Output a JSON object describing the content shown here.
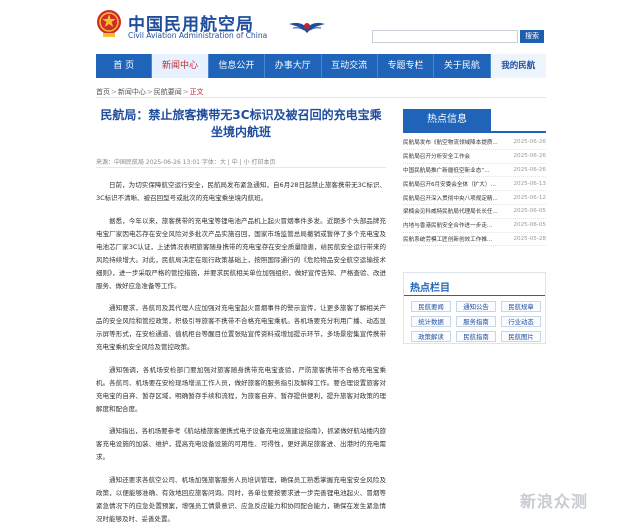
{
  "header": {
    "site_name_cn": "中国民用航空局",
    "site_name_en": "Civil Aviation Administration of China",
    "search_button": "搜索"
  },
  "nav": {
    "items": [
      "首 页",
      "新闻中心",
      "信息公开",
      "办事大厅",
      "互动交流",
      "专题专栏",
      "关于民航",
      "我的民航"
    ]
  },
  "breadcrumb": {
    "home": "首页",
    "section": "新闻中心",
    "subsection": "民航要闻",
    "current": "正文"
  },
  "article": {
    "title": "民航局：禁止旅客携带无3C标识及被召回的充电宝乘坐境内航班",
    "meta": "来源：中国民航局    2025-06-26 13:01        字体：大 | 中 | 小    打印本页",
    "paragraphs": [
      "日前，为切实保障航空运行安全，民航局发布紧急通知，自6月28日起禁止旅客携带无3C标识、3C标识不清晰、被召回型号或批次的充电宝乘坐境内航班。",
      "据悉，今年以来，旅客携带的充电宝等锂电池产品机上起火冒烟事件多发。近期多个头部品牌充电宝厂家因电芯存在安全风险对多批次产品实施召回，国家市场监管总局撤销或暂停了多个充电宝及电池芯厂家3C认证，上述情况表明旅客随身携带的充电宝存在安全质量隐患，给民航安全运行带来的风险持续增大。对此，民航局决定在现行政策基础上，按照国际通行的《危险物品安全航空运输技术细则》，进一步采取严格的管控措施，并要求民航相关单位加强组织，做好宣传告知、严格查验、改进服务、做好应急准备等工作。",
      "通知要求，各航司及其代理人应加强对充电宝起火冒烟事件的警示宣传，让更多旅客了解相关产品的安全风险和管控政策，积极引导旅客不携带不合格充电宝乘机。各机场要充分利用广播、动态显示屏等形式，在安检通道、值机柜台等醒目位置张贴宣传资料或增加提示环节，多场景密集宣传携带充电宝乘机安全风险及管控政策。",
      "通知强调，各机场安检部门要加强对旅客随身携带充电宝查验，严防旅客携带不合格充电宝乘机。各航司、机场要在安检现场增派工作人员，做好旅客的服务指引及解释工作。要合理设置旅客对充电宝的自弃、暂存区域，明确暂存手续和流程，为旅客自弃、暂存提供便利，提升旅客对政策的理解度和配合度。",
      "通知指出，各机场要参考《航站楼旅客便携式电子设备充电设施建设指南》，抓紧做好航站楼内旅客充电设施的加装、维护，提高充电设备设施的可用性、可得性，更好满足旅客进、出港时的充电需求。",
      "通知还要求各航空公司、机场加强旅客服务人员培训管理，确保员工熟悉掌握充电宝安全风险及政策，以便能够准确、有效地回应旅客问询。同时，各单位要按要求进一步完善锂电池起火、冒烟等紧急情况下的应急处置预案，增强员工情景意识、应急反应能力和协同配合能力，确保在发生紧急情况时能够及时、妥善处置。"
    ]
  },
  "sidebar": {
    "hot_title": "热点信息",
    "hot_items": [
      {
        "title": "民航局发布《航空物流领域降本提质...",
        "date": "2025-06-26"
      },
      {
        "title": "民航局召开分析安全工作会",
        "date": "2025-06-26"
      },
      {
        "title": "中国民航局推广新疆低空新业态“...",
        "date": "2025-06-26"
      },
      {
        "title": "民航局召开6月安委会全体（扩大）...",
        "date": "2025-06-13"
      },
      {
        "title": "民航局召开深入贯彻中央八项规定精...",
        "date": "2025-06-12"
      },
      {
        "title": "梁楠会见科威特民航局代理局长长任...",
        "date": "2025-06-05"
      },
      {
        "title": "内地与香港民航安全合作进一步走...",
        "date": "2025-06-05"
      },
      {
        "title": "民航系统劳模工匠创新创效工作推...",
        "date": "2025-05-28"
      }
    ],
    "topics_title": "热点栏目",
    "topics": [
      "民航要闻",
      "通知公告",
      "民航规章",
      "统计数据",
      "服务指南",
      "行业动态",
      "政策解读",
      "民航指南",
      "民航图片"
    ]
  },
  "watermark": "新浪众测",
  "colors": {
    "brand_blue": "#1f64b8",
    "title_blue": "#1f4d9c",
    "accent_red": "#c1272d"
  }
}
